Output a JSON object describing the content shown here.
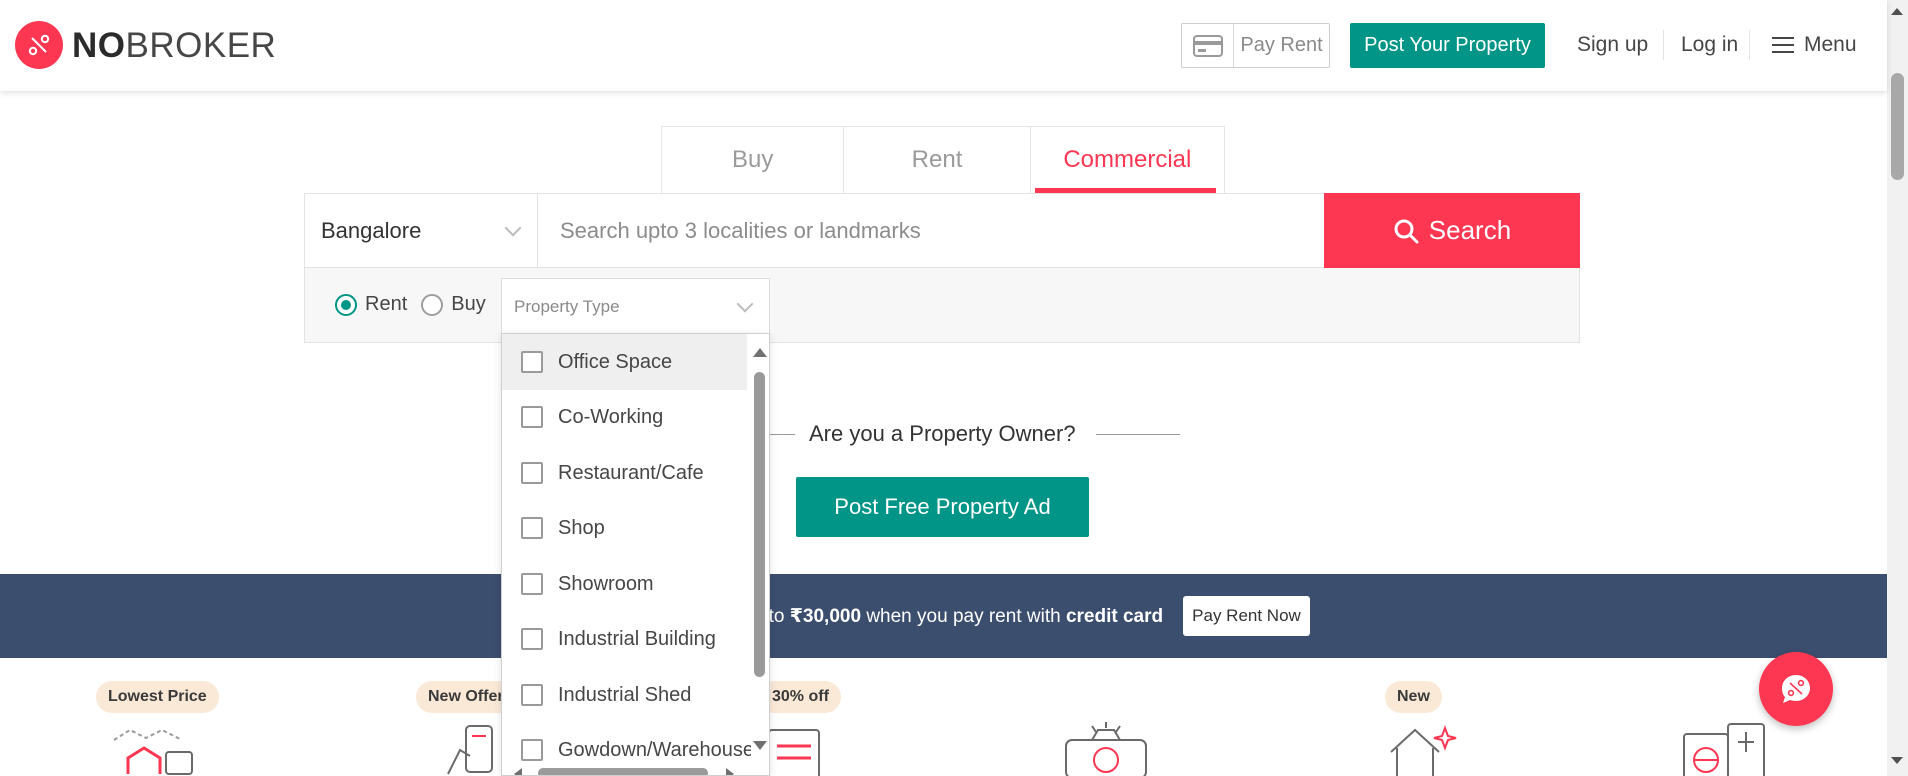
{
  "brand": {
    "logo_bold": "NO",
    "logo_rest": "BROKER",
    "color": "#fd3752"
  },
  "header": {
    "pay_rent": "Pay Rent",
    "post_property": "Post Your Property",
    "sign_up": "Sign up",
    "log_in": "Log in",
    "menu": "Menu"
  },
  "tabs": [
    {
      "label": "Buy",
      "active": false
    },
    {
      "label": "Rent",
      "active": false
    },
    {
      "label": "Commercial",
      "active": true
    }
  ],
  "search": {
    "city": "Bangalore",
    "placeholder": "Search upto 3 localities or landmarks",
    "button": "Search"
  },
  "options": {
    "rent": {
      "label": "Rent",
      "selected": true
    },
    "buy": {
      "label": "Buy",
      "selected": false
    },
    "property_type_placeholder": "Property Type"
  },
  "property_types": [
    {
      "label": "Office Space",
      "checked": false,
      "highlighted": true
    },
    {
      "label": "Co-Working",
      "checked": false
    },
    {
      "label": "Restaurant/Cafe",
      "checked": false
    },
    {
      "label": "Shop",
      "checked": false
    },
    {
      "label": "Showroom",
      "checked": false
    },
    {
      "label": "Industrial Building",
      "checked": false
    },
    {
      "label": "Industrial Shed",
      "checked": false
    },
    {
      "label": "Gowdown/Warehouse",
      "checked": false
    }
  ],
  "owner": {
    "question": "Are you a Property Owner?",
    "cta": "Post Free Property Ad"
  },
  "banner": {
    "prefix": "pto ",
    "amount": "₹30,000",
    "middle": " when you pay rent with ",
    "highlight": "credit card",
    "button": "Pay Rent Now"
  },
  "badges": [
    "Lowest Price",
    "New Offer",
    "30% off",
    "New"
  ],
  "colors": {
    "accent": "#fd3752",
    "teal": "#009587",
    "banner": "#3c4e6e",
    "badge_bg": "#fbe9d7"
  }
}
